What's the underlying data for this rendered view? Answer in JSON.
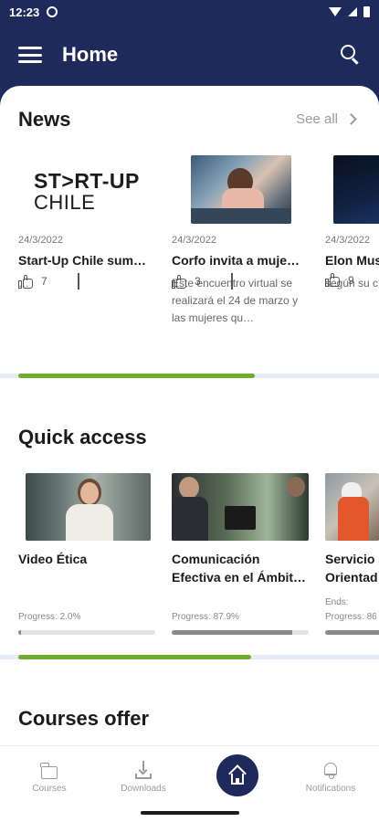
{
  "status_bar": {
    "time": "12:23"
  },
  "app_bar": {
    "title": "Home"
  },
  "news": {
    "title": "News",
    "see_all": "See all",
    "items": [
      {
        "logo_line1": "ST>RT-UP",
        "logo_line2": "CHILE",
        "date": "24/3/2022",
        "title": "Start-Up Chile sum…",
        "desc": "…",
        "likes": "7"
      },
      {
        "date": "24/3/2022",
        "title": "Corfo invita a muje…",
        "desc": "Este encuentro virtual se realizará el 24 de marzo y las mujeres qu…",
        "likes": "3"
      },
      {
        "date": "24/3/2022",
        "title": "Elon Mus",
        "desc": "según su c",
        "likes": "9"
      }
    ],
    "scroll_progress": 0.69
  },
  "quick_access": {
    "title": "Quick access",
    "items": [
      {
        "title_lines": [
          "Video Ética"
        ],
        "ends": "",
        "progress_label": "Progress: 2.0%",
        "progress": 0.02
      },
      {
        "title_lines": [
          "Comunicación",
          "Efectiva en el Ámbit…"
        ],
        "ends": "",
        "progress_label": "Progress: 87.9%",
        "progress": 0.879
      },
      {
        "title_lines": [
          "Servicio",
          "Orientad"
        ],
        "ends": "Ends:",
        "progress_label": "Progress: 86",
        "progress": 0.86
      }
    ],
    "scroll_progress": 0.68
  },
  "courses": {
    "title": "Courses offer"
  },
  "bottom_nav": {
    "courses": "Courses",
    "downloads": "Downloads",
    "notifications": "Notifications"
  }
}
